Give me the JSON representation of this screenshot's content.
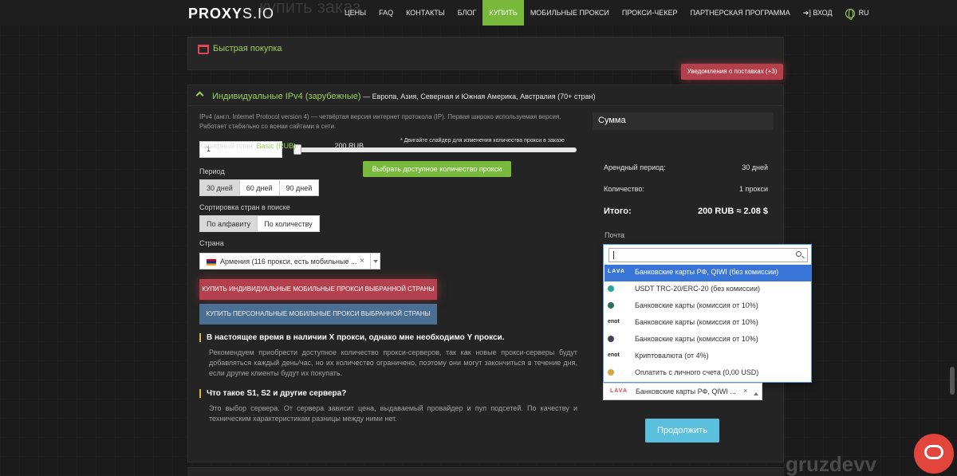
{
  "nav": {
    "logo_bold": "PROXY",
    "logo_thin": "S.IO",
    "ghost_title": "купить заказ",
    "items": [
      {
        "label": "ЦЕНЫ"
      },
      {
        "label": "FAQ"
      },
      {
        "label": "КОНТАКТЫ"
      },
      {
        "label": "БЛОГ"
      },
      {
        "label": "КУПИТЬ",
        "active": true
      },
      {
        "label": "МОБИЛЬНЫЕ ПРОКСИ"
      },
      {
        "label": "ПРОКСИ-ЧЕКЕР"
      },
      {
        "label": "ПАРТНЕРСКАЯ ПРОГРАММА"
      },
      {
        "label": "ВХОД"
      },
      {
        "label": "RU"
      }
    ]
  },
  "quick": {
    "title": "Быстрая покупка",
    "notify_button": "Уведомления о поставках (+3)"
  },
  "main": {
    "title": "Индивидуальные IPv4 (зарубежные)",
    "subtitle": " — Европа, Азия, Северная и Южная Америка, Австралия (70+ стран)",
    "description": "IPv4 (англ. Internet Protocol version 4) — четвёртая версия интернет протокола (IP). Первая широко используемая версия. Работает стабильно со всеми сайтами в сети.",
    "quantity_value": "1",
    "slider_hint": "* Двигайте слайдер для изменения количества прокси в заказе",
    "slider_fraction": 0,
    "available_button": "Выбрать доступное количество прокси",
    "period_label": "Период",
    "periods": [
      "30 дней",
      "60 дней",
      "90 дней"
    ],
    "sort_label": "Сортировка стран в поиске",
    "sorts": [
      "По алфавиту",
      "По количеству"
    ],
    "country_label": "Страна",
    "country_value": "Армения (116 прокси, есть мобильные ...",
    "country_clear": "×",
    "buy_mobile_button": "КУПИТЬ ИНДИВИДУАЛЬНЫЕ МОБИЛЬНЫЕ ПРОКСИ ВЫБРАННОЙ СТРАНЫ",
    "buy_personal_button": "КУПИТЬ ПЕРСОНАЛЬНЫЕ МОБИЛЬНЫЕ ПРОКСИ ВЫБРАННОЙ СТРАНЫ",
    "faq": [
      {
        "q": "В настоящее время в наличии X прокси, однако мне необходимо Y прокси.",
        "a": "Рекомендуем приобрести доступное количество прокси-серверов, так как новые прокси-серверы будут добавляться каждый день/час, но их количество ограничено, поэтому они могут закончиться в течение дня, если другие клиенты будут их покупать."
      },
      {
        "q": "Что такое S1, S2 и другие сервера?",
        "a": "Это выбор сервера. От сервера зависит цена, выдаваемый провайдер и пул подсетей. По качеству и техническим характеристикам разницы между ними нет."
      }
    ]
  },
  "summary": {
    "header": "Сумма",
    "plan_label": "Тарифный план: ",
    "plan_name": "Basic (RUB)",
    "plan_price": "200 RUB",
    "period_label": "Арендный период:",
    "period_value": "30 дней",
    "qty_label": "Количество:",
    "qty_value": "1 прокси",
    "total_label": "Итого:",
    "total_value": "200 RUB ≈ 2.08 $",
    "payment_label": "Почта"
  },
  "payment": {
    "search_placeholder": "",
    "options": [
      {
        "logo": "LAVA",
        "label": "Банковские карты РФ, QIWI (без комиссии)",
        "highlighted": true
      },
      {
        "logo": "cryptocloud",
        "label": "USDT TRC-20/ERC-20 (без комиссии)"
      },
      {
        "logo": "paypalych",
        "label": "Банковские карты (комиссия от 10%)"
      },
      {
        "logo": "enot",
        "label": "Банковские карты (комиссия от 10%)"
      },
      {
        "logo": "freekassa",
        "label": "Банковские карты (комиссия от 10%)"
      },
      {
        "logo": "enot",
        "label": "Криптовалюта (от 4%)"
      },
      {
        "logo": "balance",
        "label": "Оплатить с личного счета (0,00 USD)"
      }
    ],
    "selected_logo": "LAVA",
    "selected": "Банковские карты РФ, QIWI ...",
    "selected_clear": "×",
    "continue_button": "Продолжить"
  },
  "watermark": "gruzdevv",
  "colors": {
    "accent_green": "#78b83a",
    "accent_red": "#b3404c",
    "accent_blue": "#5bc0de"
  }
}
